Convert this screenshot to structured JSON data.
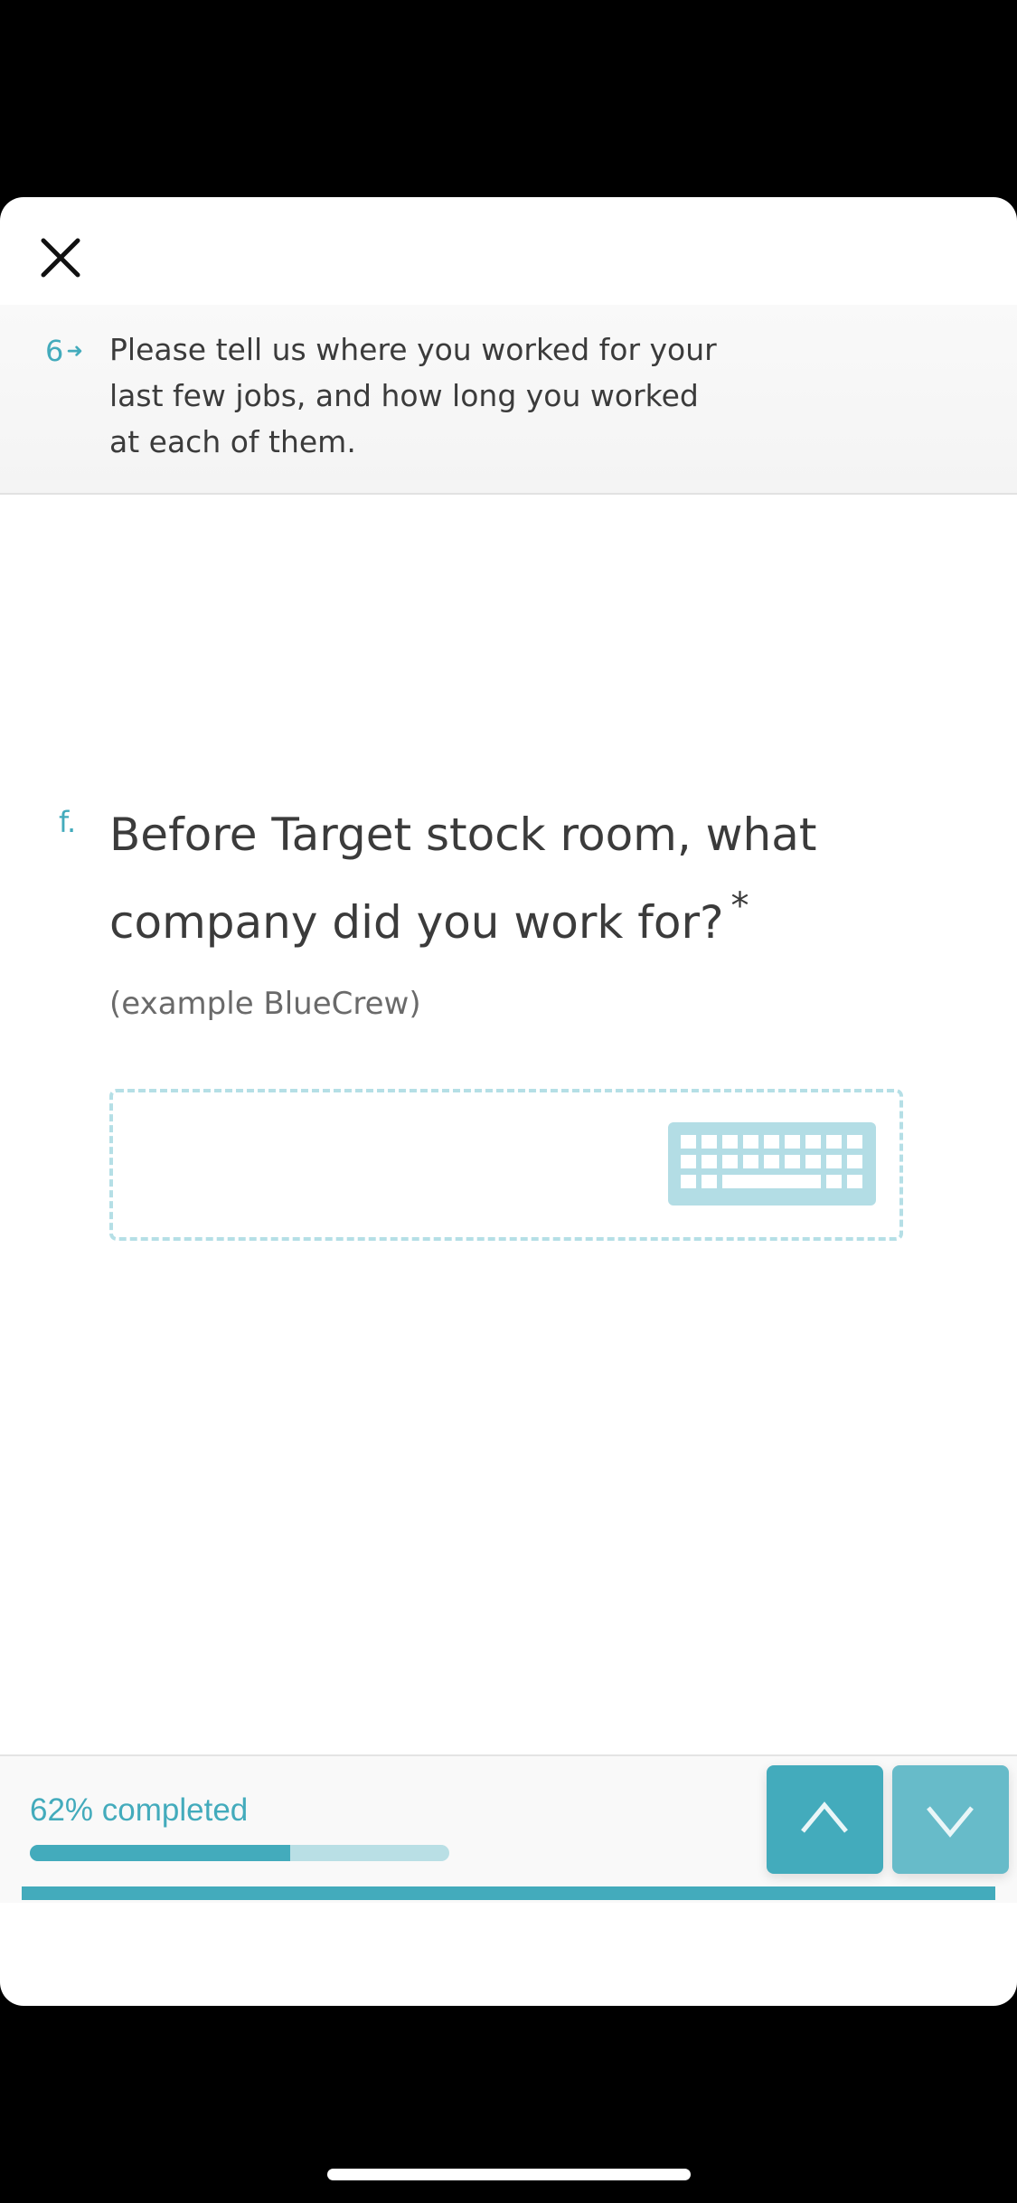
{
  "header": {
    "question_number": "6",
    "question_text": "Please tell us where you worked for your last few jobs, and how long you worked at each of them."
  },
  "subquestion": {
    "letter": "f.",
    "text": "Before Target stock room, what company did you work for?",
    "required_marker": "*",
    "example": "(example BlueCrew)",
    "answer_value": ""
  },
  "footer": {
    "progress_label": "62% completed",
    "progress_percent": 62
  },
  "colors": {
    "accent": "#43abbc",
    "accent_light": "#67bbc9",
    "progress_track": "#b9dfe5"
  },
  "icons": [
    "close-icon",
    "arrow-right-icon",
    "keyboard-icon",
    "chevron-up-icon",
    "chevron-down-icon"
  ]
}
